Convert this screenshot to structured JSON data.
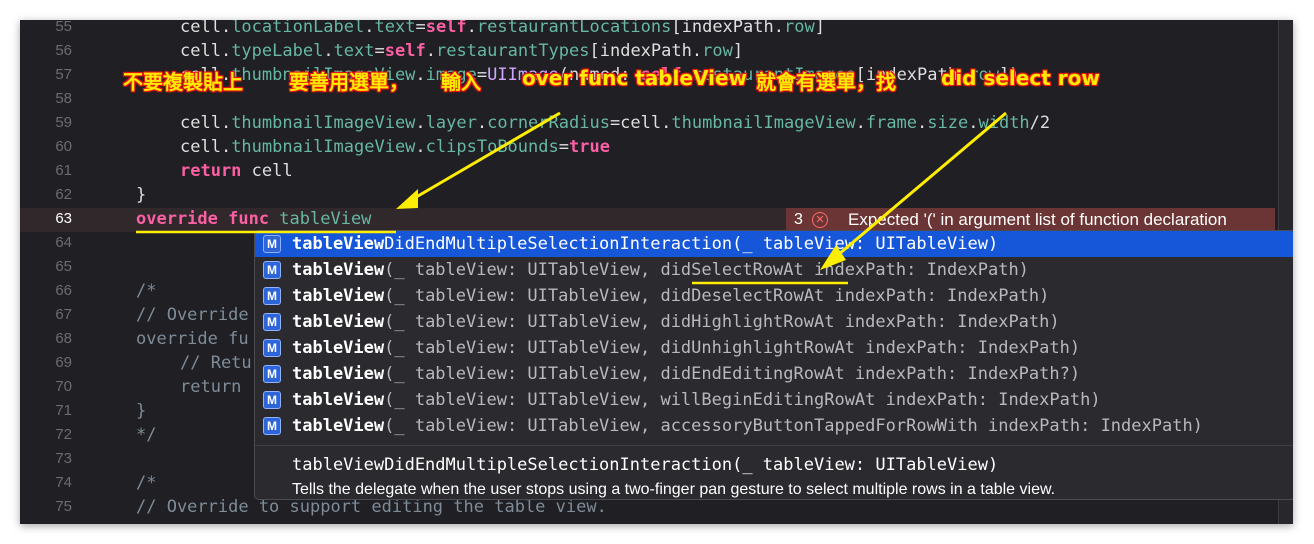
{
  "editor": {
    "lines": [
      {
        "num": "55",
        "active": false
      },
      {
        "num": "56",
        "active": false
      },
      {
        "num": "57",
        "active": false
      },
      {
        "num": "58",
        "active": false
      },
      {
        "num": "59",
        "active": false
      },
      {
        "num": "60",
        "active": false
      },
      {
        "num": "61",
        "active": false
      },
      {
        "num": "62",
        "active": false
      },
      {
        "num": "63",
        "active": true
      },
      {
        "num": "64",
        "active": false
      },
      {
        "num": "65",
        "active": false
      },
      {
        "num": "66",
        "active": false
      },
      {
        "num": "67",
        "active": false
      },
      {
        "num": "68",
        "active": false
      },
      {
        "num": "69",
        "active": false
      },
      {
        "num": "70",
        "active": false
      },
      {
        "num": "71",
        "active": false
      },
      {
        "num": "72",
        "active": false
      },
      {
        "num": "73",
        "active": false
      },
      {
        "num": "74",
        "active": false
      },
      {
        "num": "75",
        "active": false
      }
    ],
    "code": [
      [
        {
          "t": "cell.",
          "c": "plain"
        },
        {
          "t": "locationLabel",
          "c": "prop"
        },
        {
          "t": ".",
          "c": "plain"
        },
        {
          "t": "text",
          "c": "prop"
        },
        {
          "t": "=",
          "c": "plain"
        },
        {
          "t": "self",
          "c": "kw"
        },
        {
          "t": ".",
          "c": "plain"
        },
        {
          "t": "restaurantLocations",
          "c": "prop"
        },
        {
          "t": "[indexPath.",
          "c": "plain"
        },
        {
          "t": "row",
          "c": "prop"
        },
        {
          "t": "]",
          "c": "plain"
        }
      ],
      [
        {
          "t": "cell.",
          "c": "plain"
        },
        {
          "t": "typeLabel",
          "c": "prop"
        },
        {
          "t": ".",
          "c": "plain"
        },
        {
          "t": "text",
          "c": "prop"
        },
        {
          "t": "=",
          "c": "plain"
        },
        {
          "t": "self",
          "c": "kw"
        },
        {
          "t": ".",
          "c": "plain"
        },
        {
          "t": "restaurantTypes",
          "c": "prop"
        },
        {
          "t": "[indexPath.",
          "c": "plain"
        },
        {
          "t": "row",
          "c": "prop"
        },
        {
          "t": "]",
          "c": "plain"
        }
      ],
      [
        {
          "t": "cell.",
          "c": "plain"
        },
        {
          "t": "thumbnailImageView",
          "c": "prop"
        },
        {
          "t": ".",
          "c": "plain"
        },
        {
          "t": "image",
          "c": "prop"
        },
        {
          "t": "=",
          "c": "plain"
        },
        {
          "t": "UIImage",
          "c": "type"
        },
        {
          "t": "(named: ",
          "c": "plain"
        },
        {
          "t": "self",
          "c": "kw"
        },
        {
          "t": ".",
          "c": "plain"
        },
        {
          "t": "restaurantImages",
          "c": "prop"
        },
        {
          "t": "[indexPath.",
          "c": "plain"
        },
        {
          "t": "row",
          "c": "prop"
        },
        {
          "t": "])",
          "c": "plain"
        }
      ],
      [
        {
          "t": "",
          "c": "plain"
        }
      ],
      [
        {
          "t": "cell.",
          "c": "plain"
        },
        {
          "t": "thumbnailImageView",
          "c": "prop"
        },
        {
          "t": ".",
          "c": "plain"
        },
        {
          "t": "layer",
          "c": "prop"
        },
        {
          "t": ".",
          "c": "plain"
        },
        {
          "t": "cornerRadius",
          "c": "prop"
        },
        {
          "t": "=cell.",
          "c": "plain"
        },
        {
          "t": "thumbnailImageView",
          "c": "prop"
        },
        {
          "t": ".",
          "c": "plain"
        },
        {
          "t": "frame",
          "c": "prop"
        },
        {
          "t": ".",
          "c": "plain"
        },
        {
          "t": "size",
          "c": "prop"
        },
        {
          "t": ".",
          "c": "plain"
        },
        {
          "t": "width",
          "c": "prop"
        },
        {
          "t": "/2",
          "c": "plain"
        }
      ],
      [
        {
          "t": "cell.",
          "c": "plain"
        },
        {
          "t": "thumbnailImageView",
          "c": "prop"
        },
        {
          "t": ".",
          "c": "plain"
        },
        {
          "t": "clipsToBounds",
          "c": "prop"
        },
        {
          "t": "=",
          "c": "plain"
        },
        {
          "t": "true",
          "c": "kw"
        }
      ],
      [
        {
          "t": "return",
          "c": "kw"
        },
        {
          "t": " cell",
          "c": "plain"
        }
      ],
      [
        {
          "t": "}",
          "c": "plain"
        }
      ],
      [
        {
          "t": "override func ",
          "c": "kw"
        },
        {
          "t": "tableView",
          "c": "prop"
        }
      ],
      [
        {
          "t": "",
          "c": "plain"
        }
      ],
      [
        {
          "t": "",
          "c": "plain"
        }
      ],
      [
        {
          "t": "/*",
          "c": "cmt"
        }
      ],
      [
        {
          "t": "// Override",
          "c": "cmt"
        }
      ],
      [
        {
          "t": "override fu",
          "c": "cmt"
        }
      ],
      [
        {
          "t": "// Retu",
          "c": "cmt"
        }
      ],
      [
        {
          "t": "return",
          "c": "cmt"
        }
      ],
      [
        {
          "t": "}",
          "c": "cmt"
        }
      ],
      [
        {
          "t": "*/",
          "c": "cmt"
        }
      ],
      [
        {
          "t": "",
          "c": "plain"
        }
      ],
      [
        {
          "t": "/*",
          "c": "cmt"
        }
      ],
      [
        {
          "t": "// Override to support editing the table view.",
          "c": "cmt"
        }
      ]
    ],
    "indents": [
      2,
      2,
      2,
      2,
      2,
      2,
      2,
      1,
      1,
      0,
      0,
      1,
      1,
      1,
      2,
      2,
      1,
      1,
      0,
      1,
      1
    ]
  },
  "error": {
    "count": "3",
    "icon": "error-x-icon",
    "message": "Expected '(' in argument list of function declaration"
  },
  "autocomplete": {
    "icon_letter": "M",
    "suggestions": [
      {
        "bold": "tableView",
        "rest": "DidEndMultipleSelectionInteraction(_ tableView: UITableView)",
        "selected": true
      },
      {
        "bold": "tableView",
        "rest": "(_ tableView: UITableView, didSelectRowAt indexPath: IndexPath)",
        "selected": false
      },
      {
        "bold": "tableView",
        "rest": "(_ tableView: UITableView, didDeselectRowAt indexPath: IndexPath)",
        "selected": false
      },
      {
        "bold": "tableView",
        "rest": "(_ tableView: UITableView, didHighlightRowAt indexPath: IndexPath)",
        "selected": false
      },
      {
        "bold": "tableView",
        "rest": "(_ tableView: UITableView, didUnhighlightRowAt indexPath: IndexPath)",
        "selected": false
      },
      {
        "bold": "tableView",
        "rest": "(_ tableView: UITableView, didEndEditingRowAt indexPath: IndexPath?)",
        "selected": false
      },
      {
        "bold": "tableView",
        "rest": "(_ tableView: UITableView, willBeginEditingRowAt indexPath: IndexPath)",
        "selected": false
      },
      {
        "bold": "tableView",
        "rest": "(_ tableView: UITableView, accessoryButtonTappedForRowWith indexPath: IndexPath)",
        "selected": false
      }
    ],
    "doc_signature": "tableViewDidEndMultipleSelectionInteraction(_ tableView: UITableView)",
    "doc_description": "Tells the delegate when the user stops using a two-finger pan gesture to select multiple rows in a table view."
  },
  "annotation": {
    "part1": "不要複製貼上",
    "part2": "要善用選單，",
    "part3": "輸入",
    "part4": "over func tableView",
    "part5": "就會有選單，找",
    "part6": "did select row",
    "color": "#ffea00",
    "outline_color": "#e81515",
    "arrow_color": "#ffee00"
  }
}
